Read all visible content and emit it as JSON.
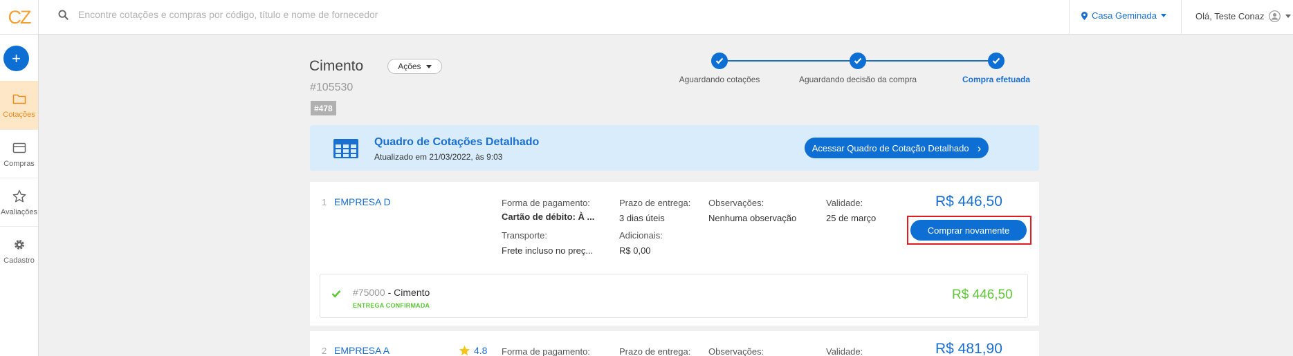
{
  "app": {
    "logo_text": "CZ"
  },
  "search": {
    "placeholder": "Encontre cotações e compras por código, título e nome de fornecedor",
    "value": ""
  },
  "header": {
    "location": "Casa Geminada",
    "greeting": "Olá, Teste Conaz"
  },
  "sidebar": {
    "add_label": "+",
    "items": [
      {
        "label": "Cotações",
        "icon": "folder-icon",
        "active": true
      },
      {
        "label": "Compras",
        "icon": "card-icon",
        "active": false
      },
      {
        "label": "Avaliações",
        "icon": "star-icon",
        "active": false
      },
      {
        "label": "Cadastro",
        "icon": "gear-icon",
        "active": false
      }
    ]
  },
  "page": {
    "title": "Cimento",
    "actions_label": "Ações",
    "code": "#105530",
    "tag": "#478"
  },
  "stepper": {
    "steps": [
      {
        "label": "Aguardando cotações",
        "done": true
      },
      {
        "label": "Aguardando decisão da compra",
        "done": true
      },
      {
        "label": "Compra efetuada",
        "done": true,
        "current": true
      }
    ]
  },
  "banner": {
    "title": "Quadro de Cotações Detalhado",
    "subtitle": "Atualizado em 21/03/2022, às 9:03",
    "button_label": "Acessar Quadro de Cotação Detalhado",
    "button_arrow": "›"
  },
  "offers": [
    {
      "rank": "1",
      "company": "EMPRESA D",
      "labels": {
        "payment": "Forma de pagamento:",
        "delivery": "Prazo de entrega:",
        "notes": "Observações:",
        "validity": "Validade:",
        "transport": "Transporte:",
        "extras": "Adicionais:"
      },
      "payment": "Cartão de débito: À ...",
      "delivery": "3 dias úteis",
      "notes": "Nenhuma observação",
      "validity": "25 de março",
      "transport": "Frete incluso no preç...",
      "extras": "R$ 0,00",
      "price": "R$ 446,50",
      "buy_label": "Comprar novamente",
      "item": {
        "code": "#75000",
        "separator": " - ",
        "name": "Cimento",
        "status": "ENTREGA CONFIRMADA",
        "price": "R$ 446,50"
      }
    },
    {
      "rank": "2",
      "company": "EMPRESA A",
      "rating": "4.8",
      "labels": {
        "payment": "Forma de pagamento:",
        "delivery": "Prazo de entrega:",
        "notes": "Observações:",
        "validity": "Validade:"
      },
      "price": "R$ 481,90"
    }
  ],
  "colors": {
    "primary": "#0d6fd4",
    "accent": "#f5a033",
    "success": "#5fc63a",
    "highlight": "#e01b22"
  }
}
